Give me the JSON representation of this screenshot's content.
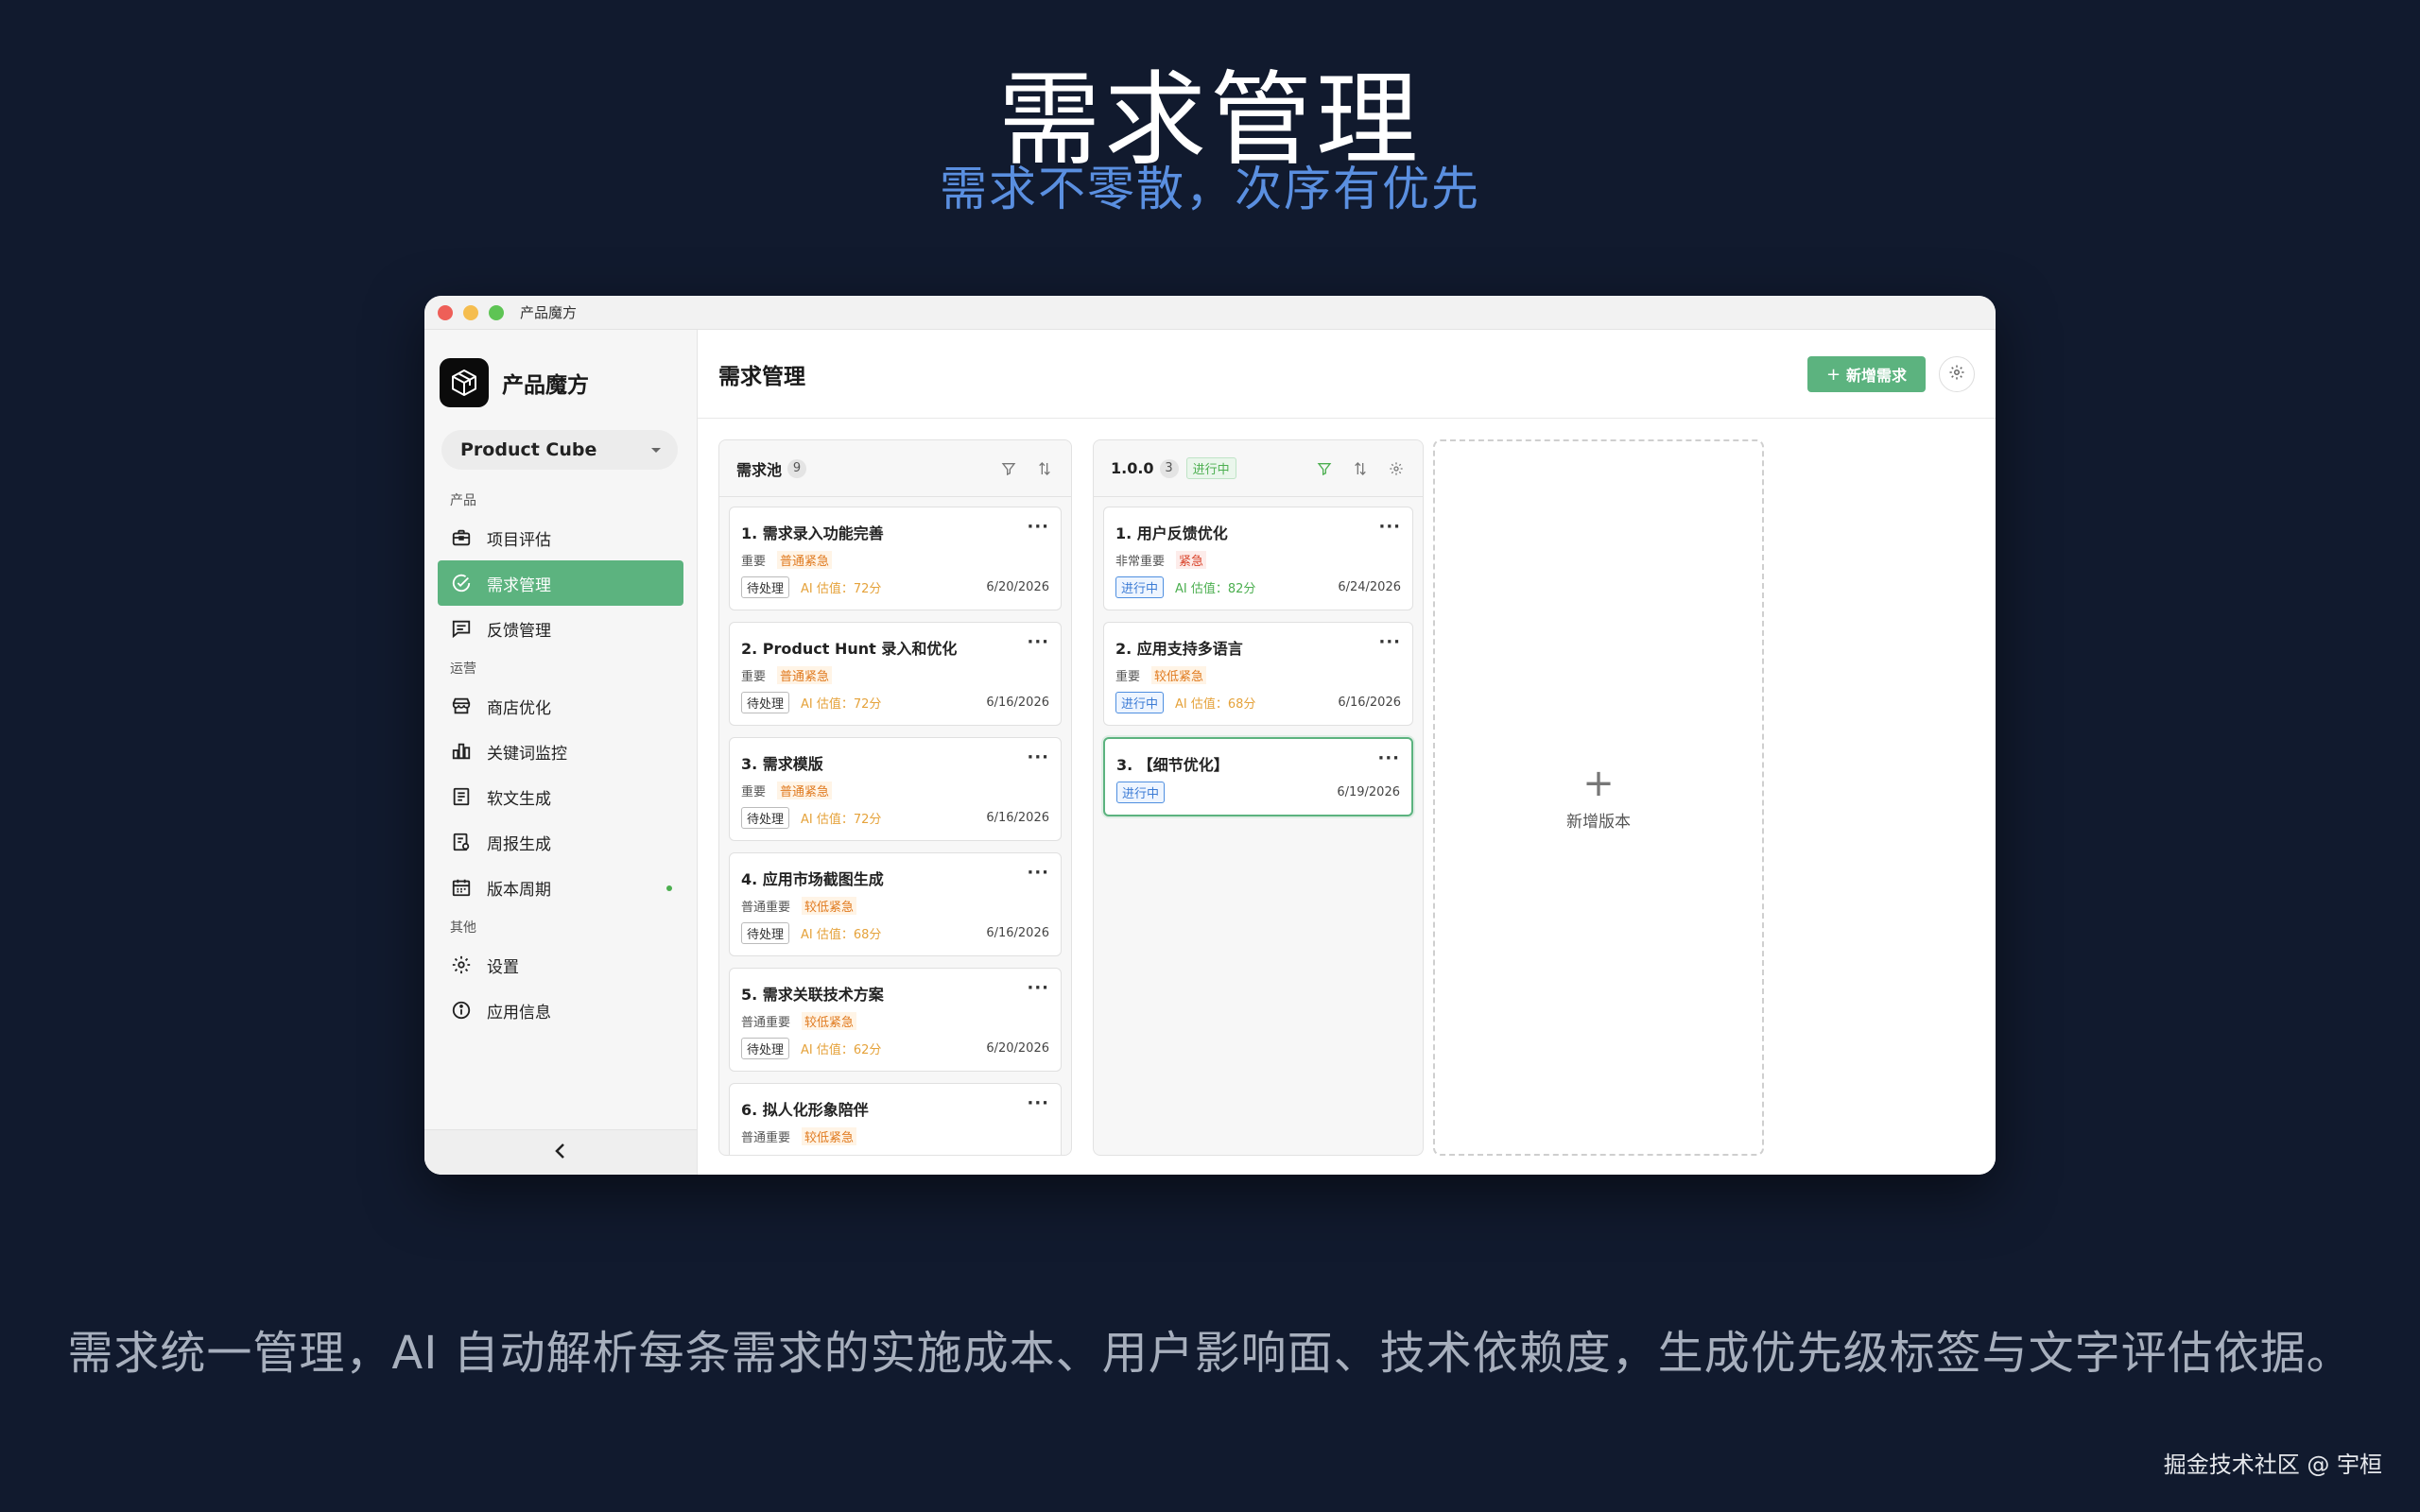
{
  "hero": {
    "title": "需求管理",
    "subtitle": "需求不零散，次序有优先"
  },
  "caption": "需求统一管理，AI 自动解析每条需求的实施成本、用户影响面、技术依赖度，生成优先级标签与文字评估依据。",
  "credit": "掘金技术社区 @ 宇桓",
  "window": {
    "title": "产品魔方"
  },
  "sidebar": {
    "brand_name": "产品魔方",
    "product_selector": "Product Cube",
    "sections": [
      {
        "label": "产品",
        "items": [
          {
            "label": "项目评估",
            "icon": "briefcase-icon"
          },
          {
            "label": "需求管理",
            "icon": "check-circle-icon",
            "active": true
          },
          {
            "label": "反馈管理",
            "icon": "message-icon"
          }
        ]
      },
      {
        "label": "运营",
        "items": [
          {
            "label": "商店优化",
            "icon": "store-icon"
          },
          {
            "label": "关键词监控",
            "icon": "bar-chart-icon"
          },
          {
            "label": "软文生成",
            "icon": "document-icon"
          },
          {
            "label": "周报生成",
            "icon": "report-icon"
          },
          {
            "label": "版本周期",
            "icon": "calendar-icon",
            "dot": true
          }
        ]
      },
      {
        "label": "其他",
        "items": [
          {
            "label": "设置",
            "icon": "gear-icon"
          },
          {
            "label": "应用信息",
            "icon": "info-icon"
          }
        ]
      }
    ]
  },
  "main": {
    "title": "需求管理",
    "add_button": "新增需求",
    "new_version_label": "新增版本"
  },
  "columns": [
    {
      "title": "需求池",
      "count": "9",
      "cards": [
        {
          "title": "1. 需求录入功能完善",
          "importance": "重要",
          "urgency": "普通紧急",
          "status": "待处理",
          "ai": "AI 估值：72分",
          "date": "6/20/2026"
        },
        {
          "title": "2. Product Hunt 录入和优化",
          "importance": "重要",
          "urgency": "普通紧急",
          "status": "待处理",
          "ai": "AI 估值：72分",
          "date": "6/16/2026"
        },
        {
          "title": "3. 需求模版",
          "importance": "重要",
          "urgency": "普通紧急",
          "status": "待处理",
          "ai": "AI 估值：72分",
          "date": "6/16/2026"
        },
        {
          "title": "4. 应用市场截图生成",
          "importance": "普通重要",
          "urgency": "较低紧急",
          "status": "待处理",
          "ai": "AI 估值：68分",
          "date": "6/16/2026"
        },
        {
          "title": "5. 需求关联技术方案",
          "importance": "普通重要",
          "urgency": "较低紧急",
          "status": "待处理",
          "ai": "AI 估值：62分",
          "date": "6/20/2026"
        },
        {
          "title": "6. 拟人化形象陪伴",
          "importance": "普通重要",
          "urgency": "较低紧急",
          "status": "",
          "ai": "",
          "date": ""
        }
      ]
    },
    {
      "title": "1.0.0",
      "count": "3",
      "status": "进行中",
      "cards": [
        {
          "title": "1. 用户反馈优化",
          "importance": "非常重要",
          "urgency": "紧急",
          "status": "进行中",
          "ai": "AI 估值：82分",
          "date": "6/24/2026"
        },
        {
          "title": "2. 应用支持多语言",
          "importance": "重要",
          "urgency": "较低紧急",
          "status": "进行中",
          "ai": "AI 估值：68分",
          "date": "6/16/2026"
        },
        {
          "title": "3. 【细节优化】",
          "importance": "",
          "urgency": "",
          "status": "进行中",
          "ai": "",
          "date": "6/19/2026"
        }
      ]
    }
  ],
  "colors": {
    "accent": "#5cb37f",
    "background": "#111a2e",
    "subtitle": "#5a8fe0"
  }
}
